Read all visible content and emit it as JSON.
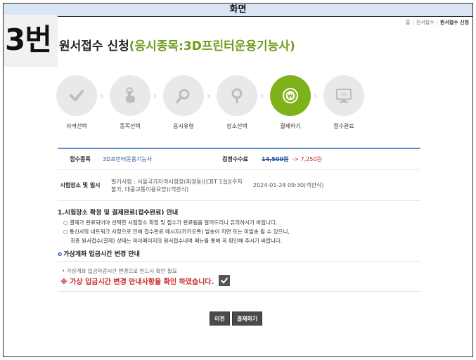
{
  "header": {
    "title": "화면"
  },
  "badge": {
    "number": "3번"
  },
  "breadcrumb": {
    "home": "홈",
    "parent": "원서접수",
    "current": "원서접수 신청"
  },
  "page_title": {
    "main": "원서접수 신청",
    "sub": "(응시종목:3D프린터운용기능사)"
  },
  "steps": [
    {
      "label": "자격선택",
      "icon": "check-icon",
      "active": false
    },
    {
      "label": "종목선택",
      "icon": "hand-pointer-icon",
      "active": false
    },
    {
      "label": "응시유형",
      "icon": "magnifier-icon",
      "active": false
    },
    {
      "label": "장소선택",
      "icon": "location-pin-icon",
      "active": false
    },
    {
      "label": "결제하기",
      "icon": "won-coin-icon",
      "active": true
    },
    {
      "label": "접수완료",
      "icon": "monitor-ok-icon",
      "active": false
    }
  ],
  "info": {
    "subject_label": "접수종목",
    "subject_value": "3D프린터운용기능사",
    "fee_label": "검정수수료",
    "fee_old": "14,500원",
    "fee_arrow": "->",
    "fee_new": "7,250원",
    "venue_label": "시험장소 및 일시",
    "venue_value": "필기시험 : 서울국가자격시험장(휘경동)[CBT 1실](주차불가, 대중교통이용요망)(객관식)",
    "datetime": "2024-01-24 09:30(객관식)"
  },
  "notice": {
    "heading": "1.시험장소 확정 및 결제완료(접수완료) 안내",
    "line1": "○ 결제가 완료되어야 선택한 시험장소 확정 및 접수가 완료됨을 알려드리니 유의하시기 바랍니다.",
    "line2": "○ 통신사와 네트워크 사정으로 인해 접수완료 메시지(카카오톡) 발송이 지연 또는 미발송 될 수 있으니,",
    "line3": "최종 원서접수(결제) 상태는 마이페이지의 원서접수내역 메뉴를 통해 꼭 확인해 주시기 바랍니다."
  },
  "virtual_account": {
    "heading": "가상계좌 입금시간 변경 안내",
    "bullet": "• 가상계좌 입금마감시간 변경으로 반드시 확인 필요",
    "confirm": "※ 가상 입금시간 변경 안내사항을 확인 하였습니다.",
    "checked": true
  },
  "buttons": {
    "prev": "이전",
    "pay": "결제하기"
  },
  "colors": {
    "accent_green": "#7fb21a",
    "title_green": "#6f9c1e",
    "link_blue": "#1d4f9a",
    "alert_red": "#c62828",
    "table_top": "#5f8fc5"
  }
}
